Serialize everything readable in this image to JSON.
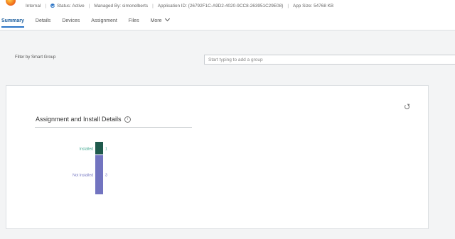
{
  "header": {
    "meta": {
      "internal": "Internal",
      "status": "Status: Active",
      "managed_by": "Managed By: simonelberts",
      "application_id": "Application ID: {26792F1C-A9D2-4020-9CC8-263951C29E08}",
      "app_size": "App Size: 54768 KB"
    }
  },
  "tabs": [
    {
      "label": "Summary",
      "active": true
    },
    {
      "label": "Details"
    },
    {
      "label": "Devices"
    },
    {
      "label": "Assignment"
    },
    {
      "label": "Files"
    },
    {
      "label": "More"
    }
  ],
  "filter": {
    "label": "Filter by Smart Group",
    "placeholder": "Start typing to add a group"
  },
  "card": {
    "title": "Assignment and Install Details"
  },
  "chart_data": {
    "type": "bar",
    "stacked": true,
    "orientation": "vertical",
    "categories": [
      "Installed",
      "Not Installed"
    ],
    "series": [
      {
        "name": "Installed",
        "value": 1,
        "color": "#1f5a4c",
        "label_color": "#3aa58d"
      },
      {
        "name": "Not Installed",
        "value": 3,
        "color": "#7274c0",
        "label_color": "#7274c0"
      }
    ],
    "total": 4
  }
}
